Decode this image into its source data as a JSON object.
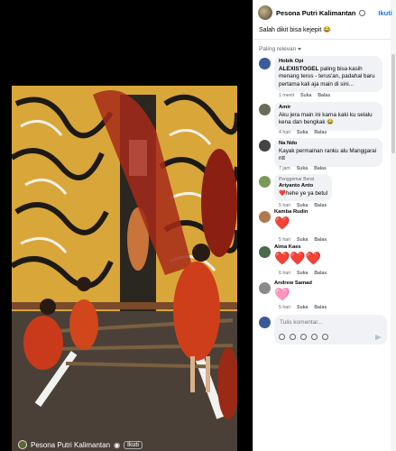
{
  "video": {
    "page_name": "Pesona Putri Kalimantan",
    "follow_label": "Ikuti"
  },
  "post": {
    "page_name": "Pesona Putri Kalimantan",
    "follow_label": "Ikuti",
    "caption": "Salah dikit bisa kejepit 😂"
  },
  "sort_label": "Paling relevan",
  "comments": [
    {
      "author": "Hobik Opi",
      "badge": "",
      "text_bold": "ALEXISTOGEL",
      "text": " paling bisa kasih menang terus - terus'an, padahal baru pertama kali aja main di sini...",
      "time": "1 menit",
      "like": "Suka",
      "reply": "Balas",
      "avatar_color": "#3b5b9a"
    },
    {
      "author": "Amir",
      "badge": "",
      "text_bold": "",
      "text": "Aku jera main ini karna kaki ku selalu kena dan bengkak 😂",
      "time": "4 hari",
      "like": "Suka",
      "reply": "Balas",
      "avatar_color": "#6b6b5a"
    },
    {
      "author": "Na Ndo",
      "badge": "",
      "text_bold": "",
      "text": "Kayak permainan ranku alu Manggarai ntt",
      "time": "7 jam",
      "like": "Suka",
      "reply": "Balas",
      "avatar_color": "#444"
    },
    {
      "author": "Ariyanto Anto",
      "badge": "Penggemar Berat",
      "text_bold": "",
      "text": "❤️hehe ye ya betul",
      "time": "5 hari",
      "like": "Suka",
      "reply": "Balas",
      "avatar_color": "#7a9a5a"
    },
    {
      "author": "Kamba Rudin",
      "badge": "",
      "text_bold": "",
      "text": "",
      "hearts": "❤️",
      "time": "5 hari",
      "like": "Suka",
      "reply": "Balas",
      "avatar_color": "#b07a50"
    },
    {
      "author": "Alma Kaes",
      "badge": "",
      "text_bold": "",
      "text": "",
      "hearts": "❤️❤️❤️",
      "time": "6 hari",
      "like": "Suka",
      "reply": "Balas",
      "avatar_color": "#4a6a4a"
    },
    {
      "author": "Andrew Samad",
      "badge": "",
      "text_bold": "",
      "text": "",
      "hearts": "🩷",
      "time": "5 hari",
      "like": "Suka",
      "reply": "Balas",
      "avatar_color": "#8a8a8a"
    }
  ],
  "compose": {
    "placeholder": "Tulis komentar..."
  }
}
